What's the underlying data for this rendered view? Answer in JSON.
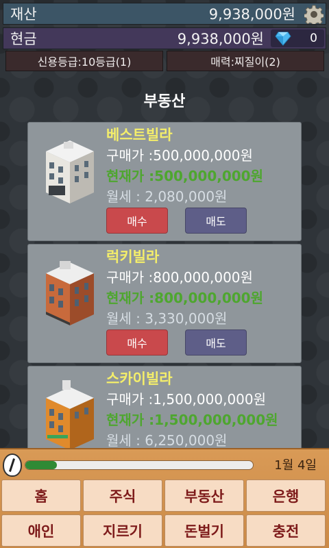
{
  "header": {
    "assets_label": "재산",
    "assets_value": "9,938,000원",
    "cash_label": "현금",
    "cash_value": "9,938,000원",
    "gem_count": "0",
    "credit_label": "신용등급:10등급(1)",
    "charm_label": "매력:찌질이(2)"
  },
  "section_title": "부동산",
  "properties": [
    {
      "name": "베스트빌라",
      "buy_price": "구매가 :500,000,000원",
      "current_price": "현재가 :500,000,000원",
      "monthly_rent": "월세 : 2,080,000원",
      "buy_label": "매수",
      "sell_label": "매도",
      "building_style": "white"
    },
    {
      "name": "럭키빌라",
      "buy_price": "구매가 :800,000,000원",
      "current_price": "현재가 :800,000,000원",
      "monthly_rent": "월세 : 3,330,000원",
      "buy_label": "매수",
      "sell_label": "매도",
      "building_style": "brick"
    },
    {
      "name": "스카이빌라",
      "buy_price": "구매가 :1,500,000,000원",
      "current_price": "현재가 :1,500,000,000원",
      "monthly_rent": "월세 : 6,250,000원",
      "buy_label": "매수",
      "sell_label": "매도",
      "building_style": "orange"
    }
  ],
  "bottom": {
    "date": "1월 4일",
    "progress_fraction": 0.14,
    "menu": [
      {
        "id": "home",
        "label": "홈"
      },
      {
        "id": "stocks",
        "label": "주식"
      },
      {
        "id": "realestate",
        "label": "부동산"
      },
      {
        "id": "bank",
        "label": "은행"
      },
      {
        "id": "lover",
        "label": "애인"
      },
      {
        "id": "shopping",
        "label": "지르기"
      },
      {
        "id": "earn",
        "label": "돈벌기"
      },
      {
        "id": "charge",
        "label": "충전"
      }
    ]
  },
  "colors": {
    "assets_bar": "#3c5566",
    "cash_bar": "#43385a",
    "current_price": "#4ea62f",
    "property_name": "#f4ee6a",
    "buy_button": "#c9494c",
    "sell_button": "#5e5e88",
    "menu_text": "#7d1a1a"
  },
  "icons": {
    "settings": "gear-icon",
    "gem": "diamond-icon",
    "clock": "clock-icon"
  }
}
